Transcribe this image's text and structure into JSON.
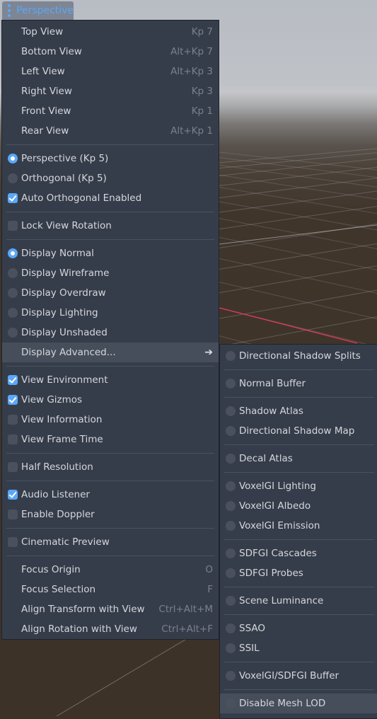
{
  "view_button": {
    "label": "Perspective",
    "icon": "kebab-menu-icon"
  },
  "colors": {
    "accent": "#5aa8f7",
    "menu_bg": "#363d4a",
    "highlight": "#474e5b",
    "text": "#d4d7dc",
    "shortcut": "#7b808a"
  },
  "main_menu": {
    "groups": [
      [
        {
          "label": "Top View",
          "shortcut": "Kp 7"
        },
        {
          "label": "Bottom View",
          "shortcut": "Alt+Kp 7"
        },
        {
          "label": "Left View",
          "shortcut": "Alt+Kp 3"
        },
        {
          "label": "Right View",
          "shortcut": "Kp 3"
        },
        {
          "label": "Front View",
          "shortcut": "Kp 1"
        },
        {
          "label": "Rear View",
          "shortcut": "Alt+Kp 1"
        }
      ],
      [
        {
          "label": "Perspective (Kp 5)",
          "type": "radio",
          "checked": true
        },
        {
          "label": "Orthogonal (Kp 5)",
          "type": "radio",
          "checked": false
        },
        {
          "label": "Auto Orthogonal Enabled",
          "type": "check",
          "checked": true
        }
      ],
      [
        {
          "label": "Lock View Rotation",
          "type": "check",
          "checked": false
        }
      ],
      [
        {
          "label": "Display Normal",
          "type": "radio",
          "checked": true
        },
        {
          "label": "Display Wireframe",
          "type": "radio",
          "checked": false
        },
        {
          "label": "Display Overdraw",
          "type": "radio",
          "checked": false
        },
        {
          "label": "Display Lighting",
          "type": "radio",
          "checked": false
        },
        {
          "label": "Display Unshaded",
          "type": "radio",
          "checked": false
        },
        {
          "label": "Display Advanced...",
          "submenu": true,
          "highlighted": true
        }
      ],
      [
        {
          "label": "View Environment",
          "type": "check",
          "checked": true
        },
        {
          "label": "View Gizmos",
          "type": "check",
          "checked": true
        },
        {
          "label": "View Information",
          "type": "check",
          "checked": false
        },
        {
          "label": "View Frame Time",
          "type": "check",
          "checked": false
        }
      ],
      [
        {
          "label": "Half Resolution",
          "type": "check",
          "checked": false
        }
      ],
      [
        {
          "label": "Audio Listener",
          "type": "check",
          "checked": true
        },
        {
          "label": "Enable Doppler",
          "type": "check",
          "checked": false
        }
      ],
      [
        {
          "label": "Cinematic Preview",
          "type": "check",
          "checked": false
        }
      ],
      [
        {
          "label": "Focus Origin",
          "shortcut": "O"
        },
        {
          "label": "Focus Selection",
          "shortcut": "F"
        },
        {
          "label": "Align Transform with View",
          "shortcut": "Ctrl+Alt+M"
        },
        {
          "label": "Align Rotation with View",
          "shortcut": "Ctrl+Alt+F"
        }
      ]
    ]
  },
  "sub_menu": {
    "groups": [
      [
        {
          "label": "Directional Shadow Splits",
          "type": "radio",
          "checked": false
        }
      ],
      [
        {
          "label": "Normal Buffer",
          "type": "radio",
          "checked": false
        }
      ],
      [
        {
          "label": "Shadow Atlas",
          "type": "radio",
          "checked": false
        },
        {
          "label": "Directional Shadow Map",
          "type": "radio",
          "checked": false
        }
      ],
      [
        {
          "label": "Decal Atlas",
          "type": "radio",
          "checked": false
        }
      ],
      [
        {
          "label": "VoxelGI Lighting",
          "type": "radio",
          "checked": false
        },
        {
          "label": "VoxelGI Albedo",
          "type": "radio",
          "checked": false
        },
        {
          "label": "VoxelGI Emission",
          "type": "radio",
          "checked": false
        }
      ],
      [
        {
          "label": "SDFGI Cascades",
          "type": "radio",
          "checked": false
        },
        {
          "label": "SDFGI Probes",
          "type": "radio",
          "checked": false
        }
      ],
      [
        {
          "label": "Scene Luminance",
          "type": "radio",
          "checked": false
        }
      ],
      [
        {
          "label": "SSAO",
          "type": "radio",
          "checked": false
        },
        {
          "label": "SSIL",
          "type": "radio",
          "checked": false
        }
      ],
      [
        {
          "label": "VoxelGI/SDFGI Buffer",
          "type": "radio",
          "checked": false
        }
      ],
      [
        {
          "label": "Disable Mesh LOD",
          "type": "radio",
          "checked": false,
          "highlighted": true
        }
      ]
    ]
  }
}
